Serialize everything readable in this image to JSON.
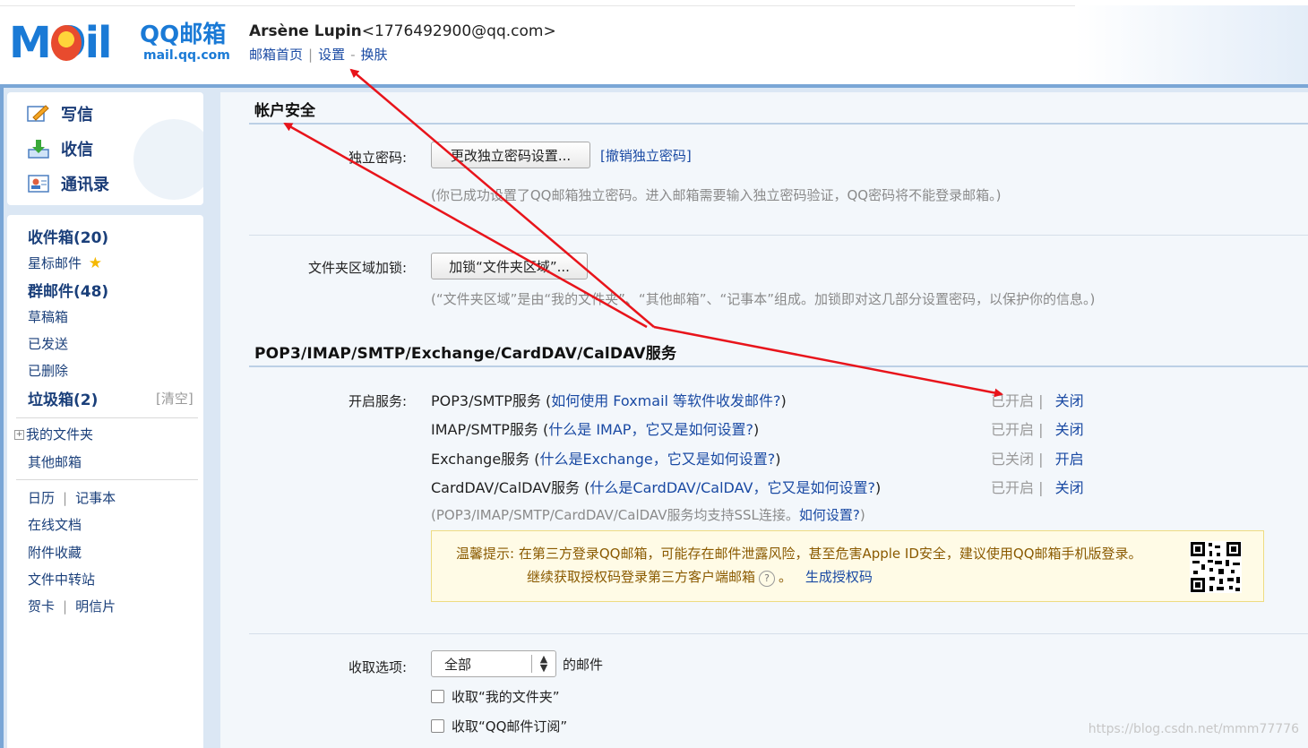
{
  "header": {
    "logo_mail": "MOil",
    "logo_cn": "QQ邮箱",
    "logo_domain": "mail.qq.com",
    "user_name": "Arsène Lupin",
    "user_email": "<1776492900@qq.com>",
    "links": [
      "邮箱首页",
      "设置",
      "换肤"
    ]
  },
  "sidebar": {
    "actions": [
      {
        "label": "写信",
        "icon": "compose-icon"
      },
      {
        "label": "收信",
        "icon": "inbox-download-icon"
      },
      {
        "label": "通讯录",
        "icon": "contacts-icon"
      }
    ],
    "folders": [
      {
        "label": "收件箱(20)",
        "bold": true
      },
      {
        "label": "星标邮件",
        "bold": false,
        "icon": "star-icon"
      },
      {
        "label": "群邮件(48)",
        "bold": true
      },
      {
        "label": "草稿箱",
        "bold": false
      },
      {
        "label": "已发送",
        "bold": false
      },
      {
        "label": "已删除",
        "bold": false
      },
      {
        "label": "垃圾箱(2)",
        "bold": true
      }
    ],
    "clear_label": "[清空]",
    "my_folders": "我的文件夹",
    "other_mailbox": "其他邮箱",
    "tools": {
      "calendar": "日历",
      "notebook": "记事本",
      "docs": "在线文档",
      "attachments": "附件收藏",
      "transfer": "文件中转站",
      "card": "贺卡",
      "postcard": "明信片"
    }
  },
  "account_security": {
    "title": "帐户安全",
    "password_label": "独立密码:",
    "password_button": "更改独立密码设置...",
    "password_cancel": "[撤销独立密码]",
    "password_hint": "(你已成功设置了QQ邮箱独立密码。进入邮箱需要输入独立密码验证，QQ密码将不能登录邮箱。)",
    "folder_lock_label": "文件夹区域加锁:",
    "folder_lock_button": "加锁“文件夹区域”...",
    "folder_lock_hint": "(“文件夹区域”是由“我的文件夹”、“其他邮箱”、“记事本”组成。加锁即对这几部分设置密码，以保护你的信息。)"
  },
  "services": {
    "title": "POP3/IMAP/SMTP/Exchange/CardDAV/CalDAV服务",
    "label": "开启服务:",
    "items": [
      {
        "name": "POP3/SMTP服务",
        "question": "如何使用 Foxmail 等软件收发邮件?",
        "status": "已开启",
        "action": "关闭"
      },
      {
        "name": "IMAP/SMTP服务",
        "question": "什么是 IMAP，它又是如何设置?",
        "status": "已开启",
        "action": "关闭"
      },
      {
        "name": "Exchange服务",
        "question": "什么是Exchange，它又是如何设置?",
        "status": "已关闭",
        "action": "开启"
      },
      {
        "name": "CardDAV/CalDAV服务",
        "question": "什么是CardDAV/CalDAV，它又是如何设置?",
        "status": "已开启",
        "action": "关闭"
      }
    ],
    "ssl_hint": "(POP3/IMAP/SMTP/CardDAV/CalDAV服务均支持SSL连接。",
    "ssl_link": "如何设置?",
    "ssl_tail": ")",
    "tip_prefix": "温馨提示:",
    "tip_line1": "在第三方登录QQ邮箱，可能存在邮件泄露风险，甚至危害Apple ID安全，建议使用QQ邮箱手机版登录。",
    "tip_line2": "继续获取授权码登录第三方客户端邮箱",
    "tip_line2_end": "。",
    "tip_link": "生成授权码"
  },
  "fetch": {
    "label": "收取选项:",
    "select_value": "全部",
    "suffix": "的邮件",
    "options": [
      "收取“我的文件夹”",
      "收取“QQ邮件订阅”"
    ]
  },
  "watermark": "https://blog.csdn.net/mmm77776",
  "colors": {
    "accent": "#1a4aa3",
    "arrow": "#e8141b",
    "frame": "#7aa6d6",
    "tip_bg": "#fffbe6"
  }
}
